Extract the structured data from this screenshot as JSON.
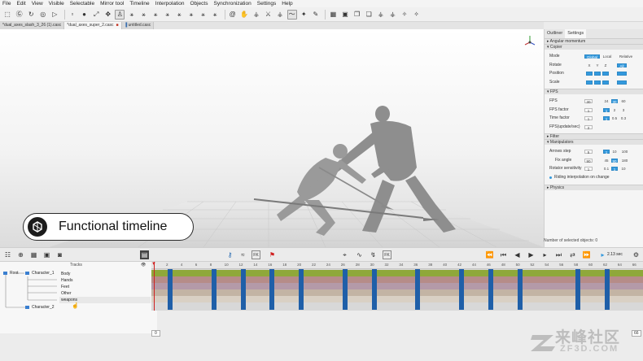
{
  "menu": [
    "File",
    "Edit",
    "View",
    "Visible",
    "Selectable",
    "Mirror tool",
    "Timeline",
    "Interpolation",
    "Objects",
    "Synchronization",
    "Settings",
    "Help"
  ],
  "tabs": [
    {
      "label": "*dual_axes_slash_3_26 (1).casc",
      "closable": false,
      "active": false
    },
    {
      "label": "*dual_axes_super_2.casc",
      "closable": true,
      "active": true
    },
    {
      "label": "untitled.casc",
      "closable": false,
      "active": false
    }
  ],
  "badge": {
    "text": "Functional timeline"
  },
  "right_panel": {
    "tabs": [
      "Outliner",
      "Settings"
    ],
    "angular_momentum": "Angular momentum",
    "copier": {
      "title": "Copier",
      "mode_label": "Mode",
      "mode_options": [
        "Global",
        "Local",
        "Relative"
      ],
      "rotate_label": "Rotate",
      "axes": [
        "X",
        "Y",
        "Z"
      ],
      "all": "All",
      "position_label": "Position",
      "scale_label": "Scale"
    },
    "fps": {
      "title": "FPS",
      "fps_label": "FPS",
      "fps_value": "30",
      "fps_options": [
        "24",
        "30",
        "60"
      ],
      "factor_label": "FPS factor",
      "factor_value": "1",
      "factor_options": [
        "1",
        "2",
        "3"
      ],
      "time_label": "Time factor",
      "time_value": "1",
      "time_options": [
        "1",
        "0.5",
        "0.3"
      ],
      "update_label": "FPS(update/sec)",
      "update_value": "2"
    },
    "filter": "Filter",
    "manipulators": {
      "title": "Manipulators",
      "arrows_label": "Arrows step",
      "arrows_value": "5",
      "arrows_options": [
        "1",
        "10",
        "100"
      ],
      "fix_label": "Fix angle",
      "fix_value": "90",
      "fix_options": [
        "45",
        "90",
        "180"
      ],
      "rot_label": "Rotator sensitivity",
      "rot_value": "1",
      "rot_options": [
        "0.1",
        "1",
        "10"
      ],
      "riding": "Riding interpolation on change"
    },
    "physics": "Physics",
    "selected": "Number of selected objects: 0"
  },
  "timeline_bar": {
    "fk1": "FK",
    "fk2": "FK",
    "time": "2.13 sec"
  },
  "tracks": {
    "header": "Tracks",
    "tree": {
      "root": "Root",
      "char1": "Character_1",
      "char2": "Character_2"
    },
    "rows": [
      "Body",
      "Hands",
      "Feet",
      "Other",
      "weapons"
    ]
  },
  "ruler": [
    "2",
    "4",
    "6",
    "8",
    "10",
    "12",
    "14",
    "16",
    "18",
    "20",
    "22",
    "24",
    "26",
    "28",
    "30",
    "32",
    "34",
    "36",
    "38",
    "40",
    "42",
    "44",
    "46",
    "48",
    "50",
    "52",
    "54",
    "56",
    "58",
    "60",
    "62",
    "64",
    "66"
  ],
  "bottom": {
    "frame": "0",
    "end": "66"
  },
  "watermark": {
    "main": "来峰社区",
    "sub": "ZF3D.COM"
  },
  "colors": {
    "accent": "#3399dd",
    "key": "#1f5fa8",
    "body": "#8fa83a",
    "hands": "#b68c88",
    "feet": "#b49aa8",
    "other": "#c3b4a4"
  }
}
